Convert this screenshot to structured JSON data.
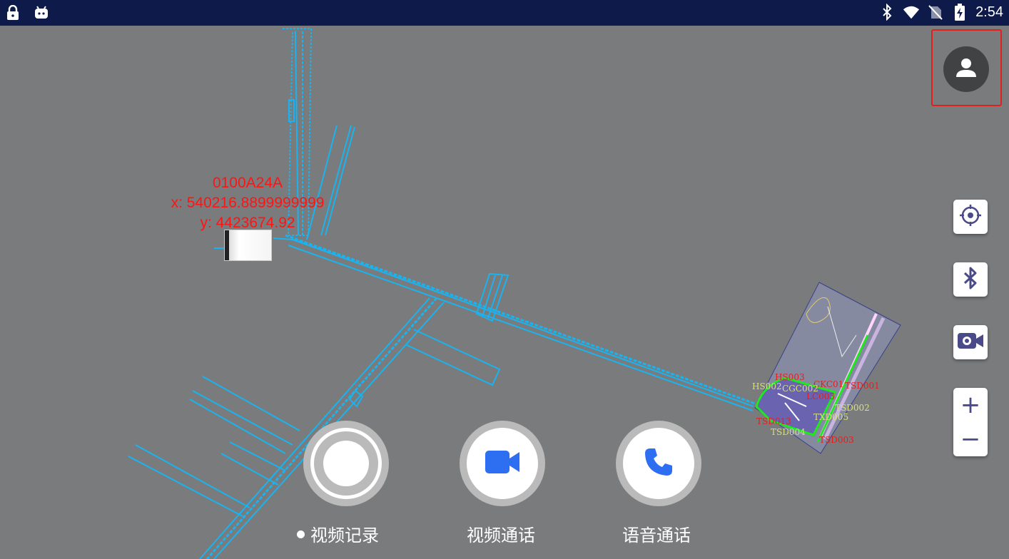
{
  "status_bar": {
    "time": "2:54",
    "left_icons": [
      "lock-icon",
      "android-icon"
    ],
    "right_icons": [
      "bluetooth-icon",
      "wifi-icon",
      "no-sim-icon",
      "battery-charging-icon"
    ]
  },
  "map": {
    "marker": {
      "id": "0100A24A",
      "x_text": "x: 540216.8899999999",
      "y_text": "y: 4423674.92"
    },
    "site_labels": [
      {
        "text": "HS003",
        "color": "#e02020"
      },
      {
        "text": "CKC01",
        "color": "#e02020"
      },
      {
        "text": "TSD001",
        "color": "#e02020"
      },
      {
        "text": "HS002",
        "color": "#d8e07a"
      },
      {
        "text": "CGC002",
        "color": "#d8e07a"
      },
      {
        "text": "TSD002",
        "color": "#d8e07a"
      },
      {
        "text": "LC003",
        "color": "#e02020"
      },
      {
        "text": "TXD005",
        "color": "#d8e07a"
      },
      {
        "text": "TSD013",
        "color": "#e02020"
      },
      {
        "text": "TSD004",
        "color": "#d8e07a"
      },
      {
        "text": "TSD003",
        "color": "#e02020"
      }
    ],
    "line_color": "#19b4f0",
    "background": "#7a7b7c"
  },
  "side_controls": {
    "profile": "person-icon",
    "buttons": [
      "locate-icon",
      "bluetooth-icon",
      "video-camera-icon"
    ],
    "zoom_in": "+",
    "zoom_out": "−"
  },
  "actions": [
    {
      "label": "视频记录",
      "icon": "record-icon"
    },
    {
      "label": "视频通话",
      "icon": "video-call-icon"
    },
    {
      "label": "语音通话",
      "icon": "phone-icon"
    }
  ],
  "colors": {
    "status_bar": "#0d1a4a",
    "accent_blue": "#2e6ff2",
    "marker_text": "#ff1414",
    "highlight_border": "#e0201c"
  }
}
